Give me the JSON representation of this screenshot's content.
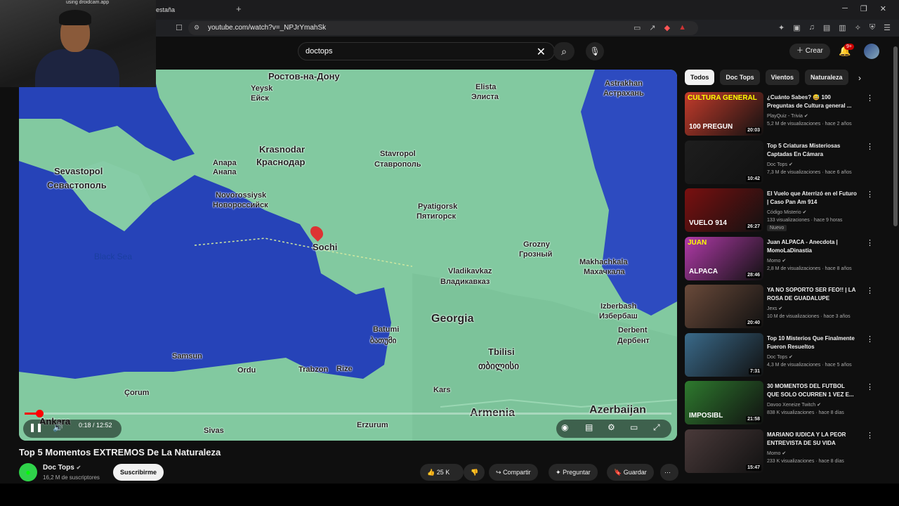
{
  "browser": {
    "tab_title": "estaña",
    "new_tab": "+",
    "url": "youtube.com/watch?v=_NPJrYmahSk"
  },
  "webcam": {
    "label": "using droidcam.app"
  },
  "header": {
    "search_value": "doctops",
    "create_label": "Crear",
    "notifications_badge": "9+"
  },
  "player": {
    "map_labels": {
      "rostov": "Ростов-на-Дону",
      "yeysk": "Yeysk",
      "yeysk_ru": "Ейск",
      "elista": "Elista",
      "elista_ru": "Элиста",
      "astrakhan": "Astrakhan",
      "astrakhan_ru": "Астрахань",
      "krasnodar": "Krasnodar",
      "krasnodar_ru": "Краснодар",
      "stavropol": "Stavropol",
      "stavropol_ru": "Ставрополь",
      "anapa": "Anapa",
      "anapa_ru": "Анапа",
      "sevastopol": "Sevastopol",
      "sevastopol_ru": "Севастополь",
      "novorossiysk": "Novorossiysk",
      "novorossiysk_ru": "Новороссийск",
      "pyatigorsk": "Pyatigorsk",
      "pyatigorsk_ru": "Пятигорск",
      "sochi": "Sochi",
      "grozny": "Grozny",
      "grozny_ru": "Грозный",
      "black_sea": "Black Sea",
      "makhachkala": "Makhachkala",
      "makhachkala_ru": "Махачкала",
      "vladikavkaz": "Vladikavkaz",
      "vladikavkaz_ru": "Владикавказ",
      "izberbash": "Izberbash",
      "izberbash_ru": "Избербаш",
      "derbent": "Derbent",
      "derbent_ru": "Дербент",
      "georgia": "Georgia",
      "batumi": "Batumi",
      "batumi_ka": "ბათუმი",
      "tbilisi": "Tbilisi",
      "tbilisi_ka": "თბილისი",
      "samsun": "Samsun",
      "ordu": "Ordu",
      "trabzon": "Trabzon",
      "rize": "Rize",
      "corum": "Çorum",
      "kars": "Kars",
      "ankara": "Ankara",
      "armenia": "Armenia",
      "azerbaijan": "Azerbaijan",
      "sivas": "Sivas",
      "erzurum": "Erzurum"
    },
    "time_display": "0:18 / 12:52",
    "progress_fraction": 0.023
  },
  "video": {
    "title": "Top 5 Momentos EXTREMOS De La Naturaleza",
    "channel": "Doc Tops",
    "subscribers": "16,2 M de suscriptores",
    "subscribe_label": "Suscribirme",
    "likes": "25 K",
    "share_label": "Compartir",
    "ask_label": "Preguntar",
    "save_label": "Guardar"
  },
  "chips": [
    "Todos",
    "Doc Tops",
    "Vientos",
    "Naturaleza"
  ],
  "recommendations": [
    {
      "title": "¿Cuánto Sabes? 😅 100 Preguntas de Cultura general ...",
      "channel": "PlayQuiz - Trivia",
      "meta": "5,2 M de visualizaciones · hace 2 años",
      "duration": "20:03",
      "thumb_text_top": "CULTURA GENERAL",
      "thumb_text_bottom": "100 PREGUN",
      "bg": "#c43b2b"
    },
    {
      "title": "Top 5 Criaturas Misteriosas Captadas En Cámara",
      "channel": "Doc Tops",
      "meta": "7,3 M de visualizaciones · hace 6 años",
      "duration": "10:42",
      "thumb_text_top": "",
      "thumb_text_bottom": "",
      "bg": "#1e1e1e"
    },
    {
      "title": "El Vuelo que Aterrizó en el Futuro | Caso Pan Am 914",
      "channel": "Código Misterio",
      "meta": "133 visualizaciones · hace 9 horas",
      "duration": "26:27",
      "thumb_text_top": "",
      "thumb_text_bottom": "VUELO 914",
      "bg": "#7a1010",
      "badge": "Nuevo"
    },
    {
      "title": "Juan ALPACA - Anecdota | MomoLaDinastia",
      "channel": "Momo",
      "meta": "2,8 M de visualizaciones · hace 8 años",
      "duration": "28:46",
      "thumb_text_top": "JUAN",
      "thumb_text_bottom": "ALPACA",
      "bg": "#b03aa8"
    },
    {
      "title": "YA NO SOPORTO SER FEO!! | LA ROSA DE GUADALUPE",
      "channel": "Jexs",
      "meta": "10 M de visualizaciones · hace 3 años",
      "duration": "20:40",
      "thumb_text_top": "",
      "thumb_text_bottom": "",
      "bg": "#6a4a3a"
    },
    {
      "title": "Top 10 Misterios Que Finalmente Fueron Resueltos",
      "channel": "Doc Tops",
      "meta": "4,3 M de visualizaciones · hace 5 años",
      "duration": "7:31",
      "thumb_text_top": "",
      "thumb_text_bottom": "",
      "bg": "#3a6a8a"
    },
    {
      "title": "30 MOMENTOS DEL FUTBOL QUE SOLO OCURREN 1 VEZ E...",
      "channel": "Davoo Xeneize Twitch",
      "meta": "838 K visualizaciones · hace 8 días",
      "duration": "21:58",
      "thumb_text_top": "",
      "thumb_text_bottom": "IMPOSIBL",
      "bg": "#2e7a2e"
    },
    {
      "title": "MARIANO IUDICA Y LA PEOR ENTREVISTA DE SU VIDA",
      "channel": "Momo",
      "meta": "233 K visualizaciones · hace 8 días",
      "duration": "15:47",
      "thumb_text_top": "",
      "thumb_text_bottom": "",
      "bg": "#4a3a3a"
    }
  ],
  "colors": {
    "accent": "#ff0000",
    "bg": "#0f0f0f",
    "chip_active": "#f1f1f1"
  }
}
